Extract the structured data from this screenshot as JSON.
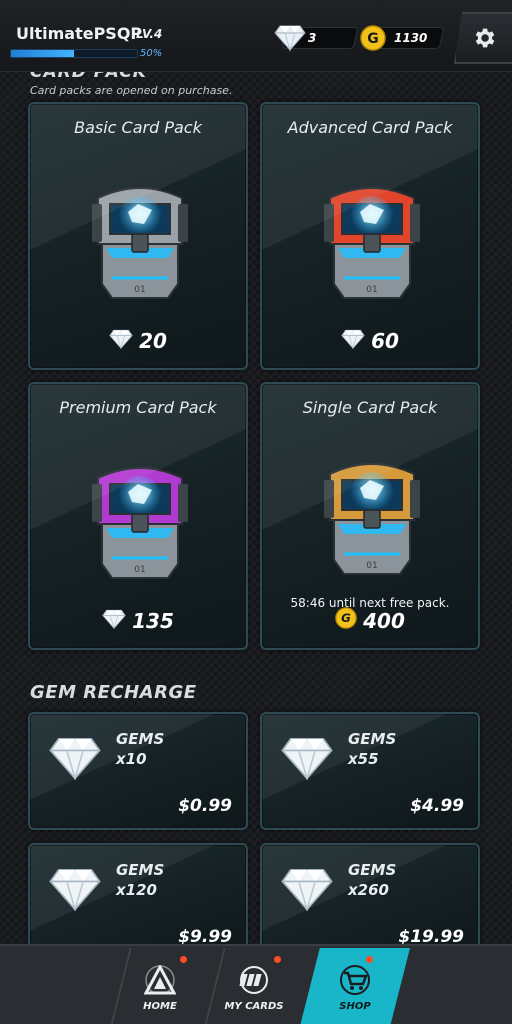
{
  "header": {
    "username": "UltimatePSQP",
    "level": "LV.4",
    "xp_percent": "50%",
    "xp_fraction": 0.5,
    "gems": "3",
    "gold": "1130",
    "settings_icon": "gear-icon"
  },
  "card_pack": {
    "section_title": "CARD PACK",
    "note": "Card packs are opened on purchase.",
    "packs": [
      {
        "title": "Basic Card Pack",
        "price": "20",
        "currency": "gem",
        "chest_color": "#9aa2a8"
      },
      {
        "title": "Advanced Card Pack",
        "price": "60",
        "currency": "gem",
        "chest_color": "#e0452b"
      },
      {
        "title": "Premium Card Pack",
        "price": "135",
        "currency": "gem",
        "chest_color": "#b13ad0"
      },
      {
        "title": "Single Card Pack",
        "price": "400",
        "currency": "gold",
        "chest_color": "#d69a3a",
        "timer": "58:46 until next free pack."
      }
    ]
  },
  "gem_recharge": {
    "section_title": "GEM RECHARGE",
    "offers": [
      {
        "label": "GEMS",
        "qty": "x10",
        "price": "$0.99"
      },
      {
        "label": "GEMS",
        "qty": "x55",
        "price": "$4.99"
      },
      {
        "label": "GEMS",
        "qty": "x120",
        "price": "$9.99"
      },
      {
        "label": "GEMS",
        "qty": "x260",
        "price": "$19.99"
      }
    ]
  },
  "nav": {
    "home": "HOME",
    "my_cards": "MY CARDS",
    "shop": "SHOP",
    "accent": "#19b6c9",
    "badge_color": "#ff4a24"
  }
}
